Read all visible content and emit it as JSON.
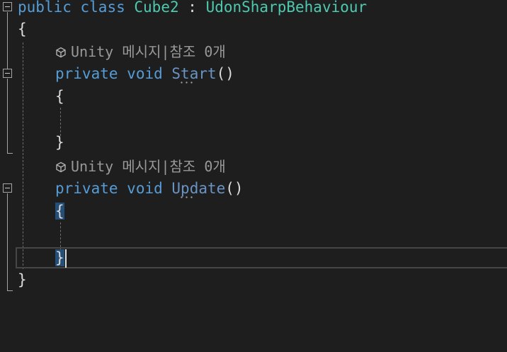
{
  "code": {
    "class_line": {
      "kw1": "public",
      "kw2": "class",
      "class_name": "Cube2",
      "colon": ":",
      "base_class": "UdonSharpBehaviour"
    },
    "open_brace": "{",
    "close_brace": "}",
    "methods": [
      {
        "codelens": {
          "unity": "Unity 메시지",
          "sep": "|",
          "refs": "참조 0개"
        },
        "kw1": "private",
        "kw2": "void",
        "name": "Start",
        "parens": "()",
        "open": "{",
        "close": "}"
      },
      {
        "codelens": {
          "unity": "Unity 메시지",
          "sep": "|",
          "refs": "참조 0개"
        },
        "kw1": "private",
        "kw2": "void",
        "name": "Update",
        "parens": "()",
        "open": "{",
        "close": "}"
      }
    ]
  },
  "colors": {
    "background": "#1e1e1e",
    "keyword": "#569cd6",
    "type": "#4ec9b0",
    "codelens": "#999999",
    "brace_highlight": "#264f78"
  },
  "icons": {
    "codelens_icon": "unity-cube-icon",
    "fold": "collapse-toggle-icon"
  }
}
